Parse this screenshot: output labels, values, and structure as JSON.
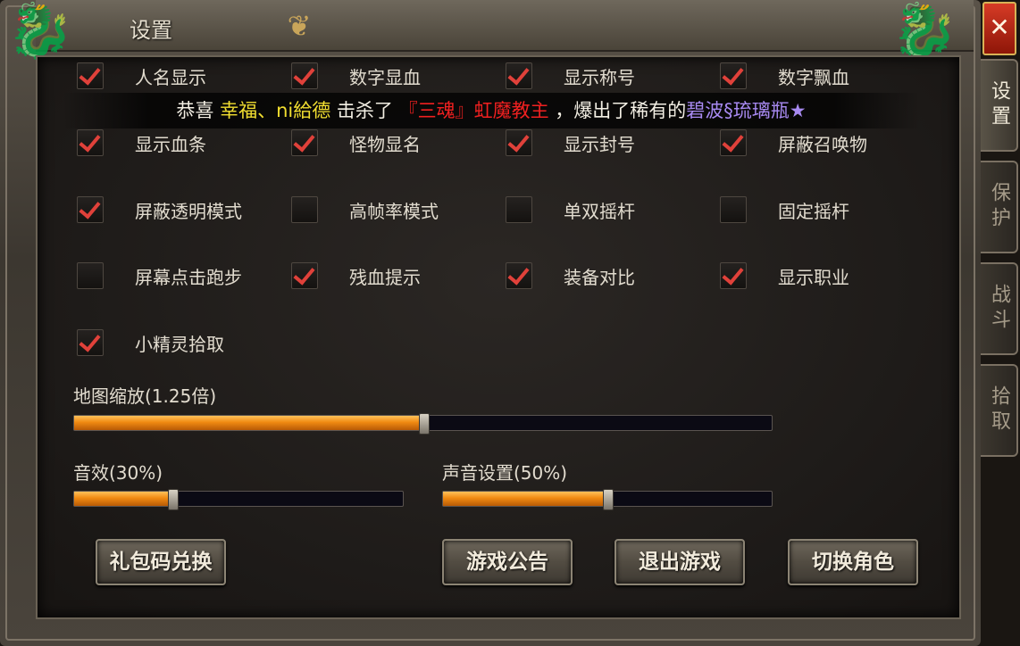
{
  "window": {
    "title": "设置",
    "close_label": "✕"
  },
  "side_tabs": [
    {
      "label": "设置",
      "active": true
    },
    {
      "label": "保护",
      "active": false
    },
    {
      "label": "战斗",
      "active": false
    },
    {
      "label": "拾取",
      "active": false
    }
  ],
  "options": [
    {
      "label": "人名显示",
      "checked": true
    },
    {
      "label": "数字显血",
      "checked": true
    },
    {
      "label": "显示称号",
      "checked": true
    },
    {
      "label": "数字飘血",
      "checked": true
    },
    {
      "label": "显示血条",
      "checked": true
    },
    {
      "label": "怪物显名",
      "checked": true
    },
    {
      "label": "显示封号",
      "checked": true
    },
    {
      "label": "屏蔽召唤物",
      "checked": true
    },
    {
      "label": "屏蔽透明模式",
      "checked": true
    },
    {
      "label": "高帧率模式",
      "checked": false
    },
    {
      "label": "单双摇杆",
      "checked": false
    },
    {
      "label": "固定摇杆",
      "checked": false
    },
    {
      "label": "屏幕点击跑步",
      "checked": false
    },
    {
      "label": "残血提示",
      "checked": true
    },
    {
      "label": "装备对比",
      "checked": true
    },
    {
      "label": "显示职业",
      "checked": true
    },
    {
      "label": "小精灵拾取",
      "checked": true
    }
  ],
  "broadcast": {
    "prefix": "恭喜 ",
    "player": "幸福、ni給德",
    "mid": " 击杀了 ",
    "boss": "『三魂』虹魔教主",
    "after": " ，爆出了稀有的",
    "item": "碧波§琉璃瓶★"
  },
  "sliders": {
    "map_zoom": {
      "label": "地图缩放(1.25倍)",
      "fraction": 0.5
    },
    "sfx": {
      "label": "音效(30%)",
      "fraction": 0.3
    },
    "sound": {
      "label": "声音设置(50%)",
      "fraction": 0.5
    }
  },
  "buttons": {
    "gift_code": "礼包码兑换",
    "announcement": "游戏公告",
    "exit_game": "退出游戏",
    "switch_role": "切换角色"
  },
  "colors": {
    "check_mark": "#e0413a",
    "slider_fill": "#f08a12",
    "broadcast_player": "#f2df30",
    "broadcast_boss": "#f02020",
    "broadcast_item": "#a88af2",
    "close_button": "#c62a16"
  }
}
